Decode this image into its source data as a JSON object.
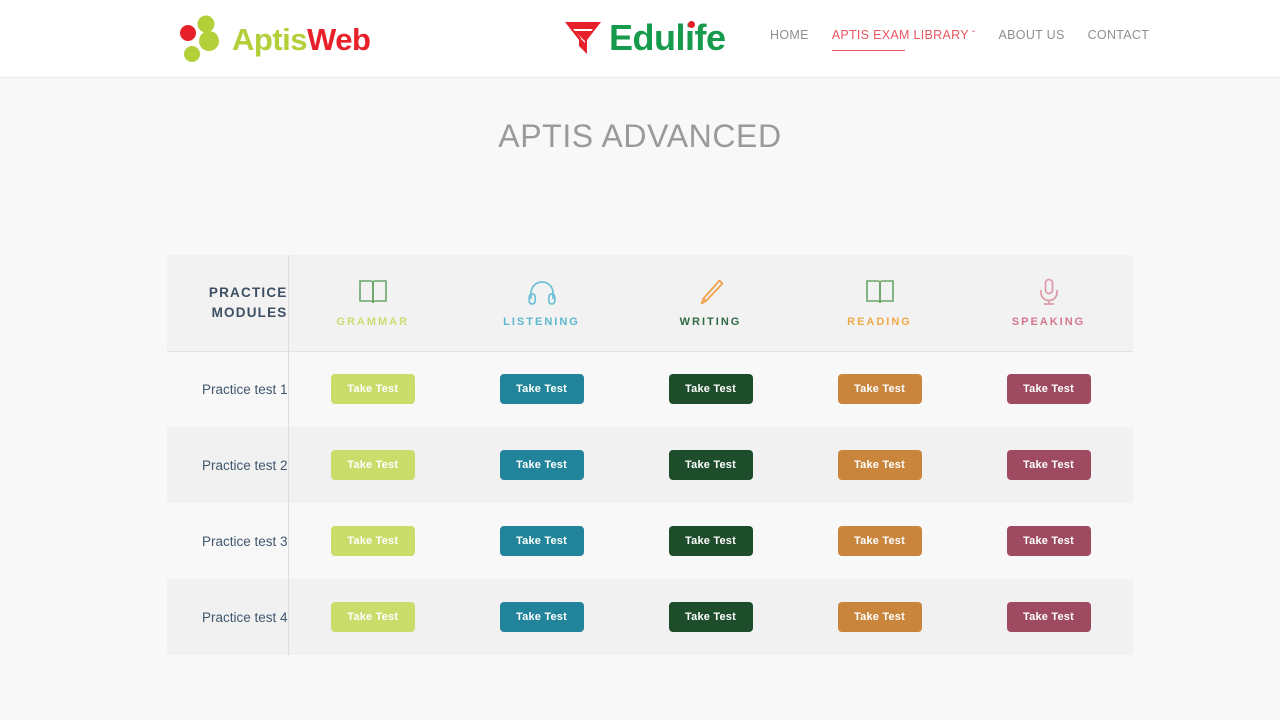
{
  "header": {
    "brand_left": {
      "text_part1": "Aptis",
      "text_part2": "Web",
      "color_green": "#b3cf3a",
      "color_red": "#e8202a"
    },
    "brand_center": {
      "text": "Edulife",
      "color_green": "#159b4b",
      "color_red": "#e8202a",
      "icon": "funnel-logo-icon"
    },
    "nav": [
      {
        "label": "HOME",
        "active": false,
        "has_chevron": false
      },
      {
        "label": "APTIS EXAM LIBRARY",
        "active": true,
        "has_chevron": true,
        "chevron": "ˇ"
      },
      {
        "label": "ABOUT US",
        "active": false,
        "has_chevron": false
      },
      {
        "label": "CONTACT",
        "active": false,
        "has_chevron": false
      }
    ],
    "active_color": "#e8565f",
    "inactive_color": "#8f8f8f"
  },
  "page": {
    "title": "APTIS ADVANCED",
    "title_color": "#9a9a9a",
    "background": "#f8f8f8"
  },
  "table": {
    "corner_label_line1": "PRACTICE",
    "corner_label_line2": "MODULES",
    "corner_label_color": "#3d4f63",
    "modules": [
      {
        "name": "GRAMMAR",
        "icon": "open-book-icon",
        "icon_color": "#6aa66a",
        "label_color": "#cddc72",
        "button_color": "#cadc6a"
      },
      {
        "name": "LISTENING",
        "icon": "headphones-icon",
        "icon_color": "#6dc0d5",
        "label_color": "#5bb8cf",
        "button_color": "#21849a"
      },
      {
        "name": "WRITING",
        "icon": "pencil-icon",
        "icon_color": "#f0a04b",
        "label_color": "#2f6b45",
        "button_color": "#1e4d2b"
      },
      {
        "name": "READING",
        "icon": "open-book-icon",
        "icon_color": "#6aa66a",
        "label_color": "#efa94a",
        "button_color": "#c9853c"
      },
      {
        "name": "SPEAKING",
        "icon": "microphone-icon",
        "icon_color": "#dd9aa8",
        "label_color": "#d4798d",
        "button_color": "#9e4a60"
      }
    ],
    "button_label": "Take Test",
    "rows": [
      {
        "label": "Practice test 1"
      },
      {
        "label": "Practice test 2"
      },
      {
        "label": "Practice test 3"
      },
      {
        "label": "Practice test 4"
      }
    ]
  }
}
